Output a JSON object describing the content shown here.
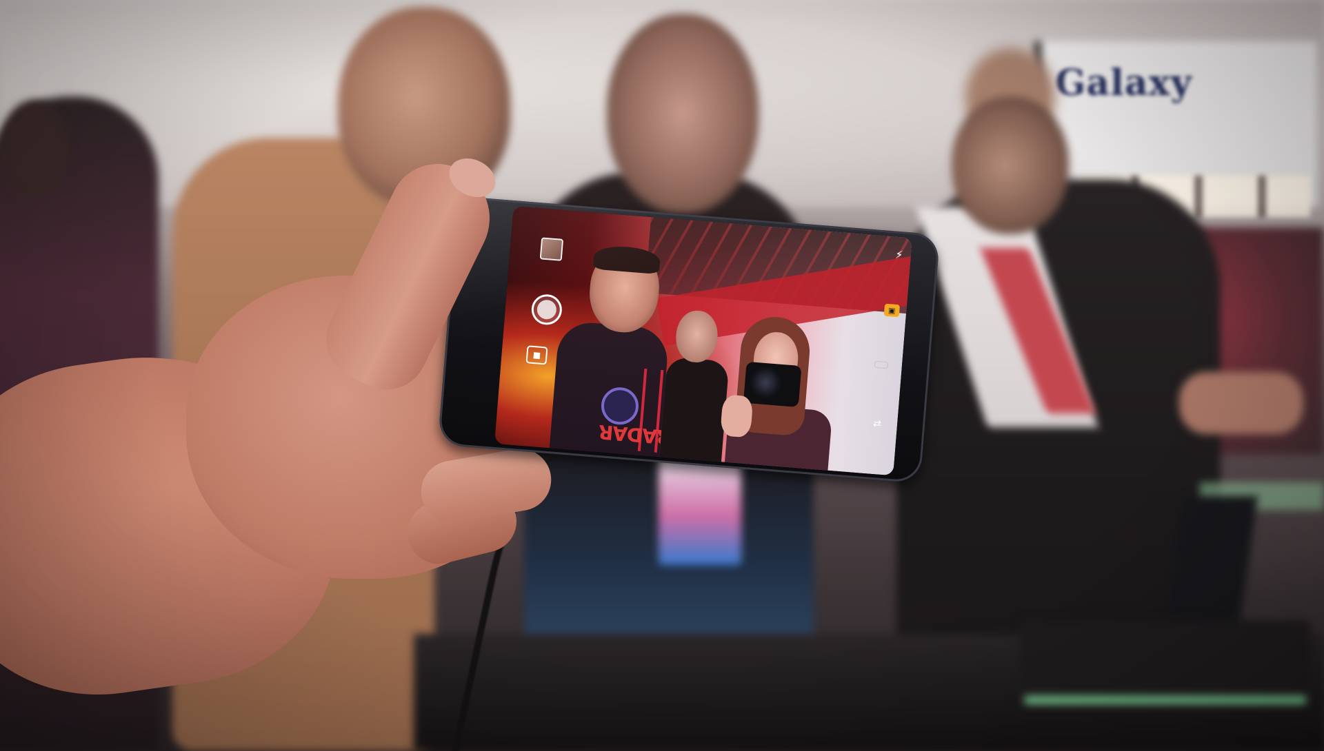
{
  "scene": {
    "background_sign_text": "Galaxy",
    "phone_viewfinder_shirt_text": "RADAR",
    "camera_ui": {
      "flash_icon": "flash-auto-icon",
      "mode_icon": "camera-mode-icon",
      "gallery_icon": "gallery-thumbnail-icon",
      "shutter_icon": "shutter-button-icon",
      "video_icon": "video-record-icon",
      "switch_icon": "switch-camera-icon",
      "mode_glyph": "▣",
      "flash_glyph": "⚡",
      "video_glyph": "■",
      "switch_glyph": "⇄"
    },
    "colors": {
      "accent_red": "#d2283e",
      "mode_badge": "#f5a922",
      "sign_text": "#27305f"
    }
  }
}
